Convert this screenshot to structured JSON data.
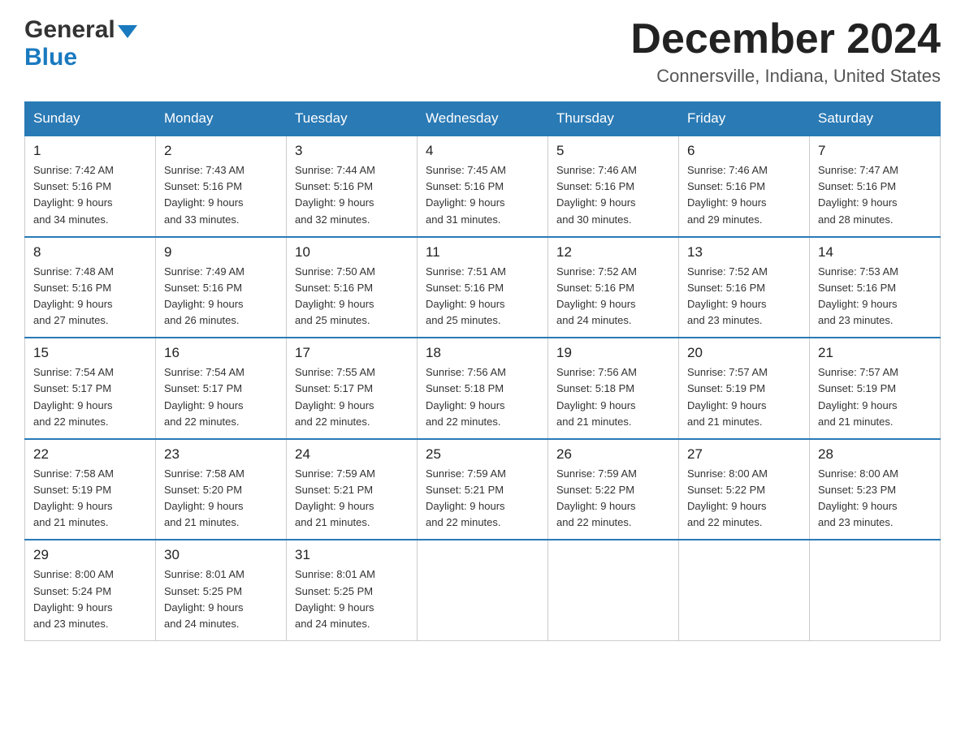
{
  "header": {
    "title": "December 2024",
    "subtitle": "Connersville, Indiana, United States",
    "logo_general": "General",
    "logo_blue": "Blue"
  },
  "weekdays": [
    "Sunday",
    "Monday",
    "Tuesday",
    "Wednesday",
    "Thursday",
    "Friday",
    "Saturday"
  ],
  "weeks": [
    [
      {
        "day": "1",
        "sunrise": "7:42 AM",
        "sunset": "5:16 PM",
        "daylight": "9 hours and 34 minutes."
      },
      {
        "day": "2",
        "sunrise": "7:43 AM",
        "sunset": "5:16 PM",
        "daylight": "9 hours and 33 minutes."
      },
      {
        "day": "3",
        "sunrise": "7:44 AM",
        "sunset": "5:16 PM",
        "daylight": "9 hours and 32 minutes."
      },
      {
        "day": "4",
        "sunrise": "7:45 AM",
        "sunset": "5:16 PM",
        "daylight": "9 hours and 31 minutes."
      },
      {
        "day": "5",
        "sunrise": "7:46 AM",
        "sunset": "5:16 PM",
        "daylight": "9 hours and 30 minutes."
      },
      {
        "day": "6",
        "sunrise": "7:46 AM",
        "sunset": "5:16 PM",
        "daylight": "9 hours and 29 minutes."
      },
      {
        "day": "7",
        "sunrise": "7:47 AM",
        "sunset": "5:16 PM",
        "daylight": "9 hours and 28 minutes."
      }
    ],
    [
      {
        "day": "8",
        "sunrise": "7:48 AM",
        "sunset": "5:16 PM",
        "daylight": "9 hours and 27 minutes."
      },
      {
        "day": "9",
        "sunrise": "7:49 AM",
        "sunset": "5:16 PM",
        "daylight": "9 hours and 26 minutes."
      },
      {
        "day": "10",
        "sunrise": "7:50 AM",
        "sunset": "5:16 PM",
        "daylight": "9 hours and 25 minutes."
      },
      {
        "day": "11",
        "sunrise": "7:51 AM",
        "sunset": "5:16 PM",
        "daylight": "9 hours and 25 minutes."
      },
      {
        "day": "12",
        "sunrise": "7:52 AM",
        "sunset": "5:16 PM",
        "daylight": "9 hours and 24 minutes."
      },
      {
        "day": "13",
        "sunrise": "7:52 AM",
        "sunset": "5:16 PM",
        "daylight": "9 hours and 23 minutes."
      },
      {
        "day": "14",
        "sunrise": "7:53 AM",
        "sunset": "5:16 PM",
        "daylight": "9 hours and 23 minutes."
      }
    ],
    [
      {
        "day": "15",
        "sunrise": "7:54 AM",
        "sunset": "5:17 PM",
        "daylight": "9 hours and 22 minutes."
      },
      {
        "day": "16",
        "sunrise": "7:54 AM",
        "sunset": "5:17 PM",
        "daylight": "9 hours and 22 minutes."
      },
      {
        "day": "17",
        "sunrise": "7:55 AM",
        "sunset": "5:17 PM",
        "daylight": "9 hours and 22 minutes."
      },
      {
        "day": "18",
        "sunrise": "7:56 AM",
        "sunset": "5:18 PM",
        "daylight": "9 hours and 22 minutes."
      },
      {
        "day": "19",
        "sunrise": "7:56 AM",
        "sunset": "5:18 PM",
        "daylight": "9 hours and 21 minutes."
      },
      {
        "day": "20",
        "sunrise": "7:57 AM",
        "sunset": "5:19 PM",
        "daylight": "9 hours and 21 minutes."
      },
      {
        "day": "21",
        "sunrise": "7:57 AM",
        "sunset": "5:19 PM",
        "daylight": "9 hours and 21 minutes."
      }
    ],
    [
      {
        "day": "22",
        "sunrise": "7:58 AM",
        "sunset": "5:19 PM",
        "daylight": "9 hours and 21 minutes."
      },
      {
        "day": "23",
        "sunrise": "7:58 AM",
        "sunset": "5:20 PM",
        "daylight": "9 hours and 21 minutes."
      },
      {
        "day": "24",
        "sunrise": "7:59 AM",
        "sunset": "5:21 PM",
        "daylight": "9 hours and 21 minutes."
      },
      {
        "day": "25",
        "sunrise": "7:59 AM",
        "sunset": "5:21 PM",
        "daylight": "9 hours and 22 minutes."
      },
      {
        "day": "26",
        "sunrise": "7:59 AM",
        "sunset": "5:22 PM",
        "daylight": "9 hours and 22 minutes."
      },
      {
        "day": "27",
        "sunrise": "8:00 AM",
        "sunset": "5:22 PM",
        "daylight": "9 hours and 22 minutes."
      },
      {
        "day": "28",
        "sunrise": "8:00 AM",
        "sunset": "5:23 PM",
        "daylight": "9 hours and 23 minutes."
      }
    ],
    [
      {
        "day": "29",
        "sunrise": "8:00 AM",
        "sunset": "5:24 PM",
        "daylight": "9 hours and 23 minutes."
      },
      {
        "day": "30",
        "sunrise": "8:01 AM",
        "sunset": "5:25 PM",
        "daylight": "9 hours and 24 minutes."
      },
      {
        "day": "31",
        "sunrise": "8:01 AM",
        "sunset": "5:25 PM",
        "daylight": "9 hours and 24 minutes."
      },
      null,
      null,
      null,
      null
    ]
  ],
  "labels": {
    "sunrise": "Sunrise:",
    "sunset": "Sunset:",
    "daylight": "Daylight:"
  }
}
